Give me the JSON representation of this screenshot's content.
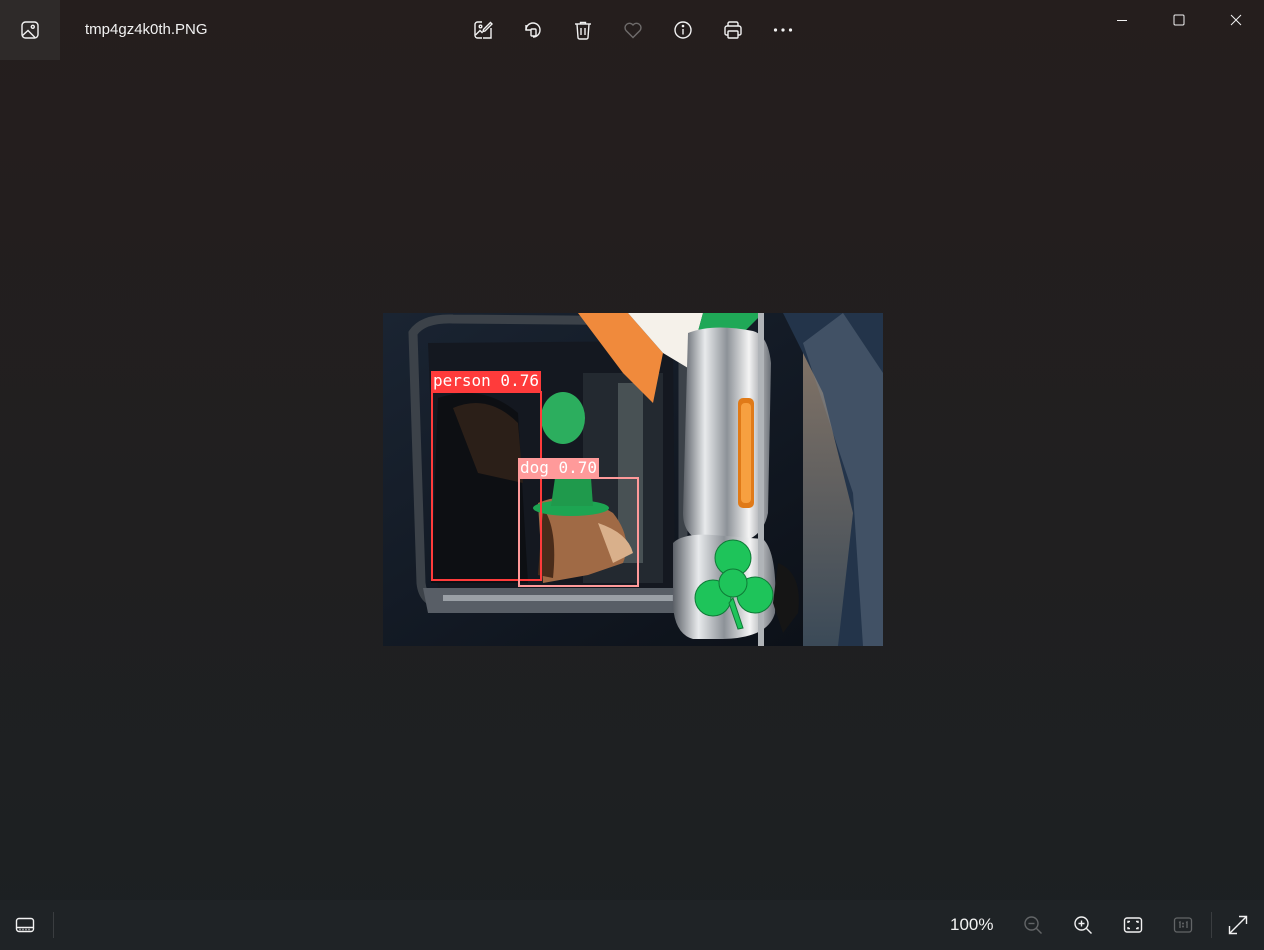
{
  "window": {
    "title": "tmp4gz4k0th.PNG"
  },
  "toolbar": {
    "buttons": [
      {
        "name": "edit-image",
        "icon": "edit-image-icon"
      },
      {
        "name": "rotate",
        "icon": "rotate-icon"
      },
      {
        "name": "delete",
        "icon": "trash-icon"
      },
      {
        "name": "favorite",
        "icon": "heart-icon"
      },
      {
        "name": "file-info",
        "icon": "info-icon"
      },
      {
        "name": "print",
        "icon": "printer-icon"
      },
      {
        "name": "more",
        "icon": "more-icon"
      }
    ]
  },
  "window_controls": [
    "minimize",
    "maximize",
    "close"
  ],
  "image": {
    "detections": [
      {
        "label": "person 0.76",
        "color": "#ff3b3b"
      },
      {
        "label": "dog 0.70",
        "color": "#ff9a9a"
      }
    ]
  },
  "bottombar": {
    "zoom": "100%",
    "buttons": [
      "filmstrip",
      "zoom-out",
      "zoom-in",
      "fit-to-window",
      "actual-size",
      "full-screen"
    ]
  },
  "colors": {
    "background": "#222022",
    "bottombar": "#1f2326",
    "app_icon_box": "#2e2a29",
    "shamrock": "#1ec45a"
  }
}
